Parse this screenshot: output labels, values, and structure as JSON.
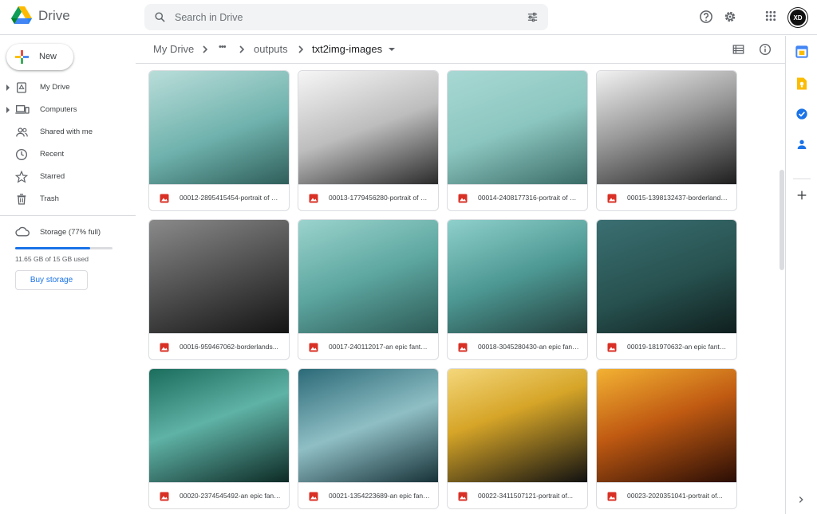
{
  "app": {
    "name": "Drive"
  },
  "search": {
    "placeholder": "Search in Drive"
  },
  "account": {
    "initials": "XD"
  },
  "sidebar": {
    "new_label": "New",
    "items": [
      {
        "label": "My Drive",
        "icon": "my-drive-icon",
        "expandable": true
      },
      {
        "label": "Computers",
        "icon": "computers-icon",
        "expandable": true
      },
      {
        "label": "Shared with me",
        "icon": "shared-icon",
        "expandable": false
      },
      {
        "label": "Recent",
        "icon": "clock-icon",
        "expandable": false
      },
      {
        "label": "Starred",
        "icon": "star-icon",
        "expandable": false
      },
      {
        "label": "Trash",
        "icon": "trash-icon",
        "expandable": false
      }
    ],
    "storage": {
      "label": "Storage (77% full)",
      "used_text": "11.65 GB of 15 GB used",
      "percent": 77,
      "buy_label": "Buy storage"
    }
  },
  "breadcrumb": {
    "items": [
      "My Drive",
      "•••",
      "outputs",
      "txt2img-images"
    ]
  },
  "files": [
    {
      "name": "00012-2895415454-portrait of geralt..."
    },
    {
      "name": "00013-1779456280-portrait of geralt..."
    },
    {
      "name": "00014-2408177316-portrait of geralt..."
    },
    {
      "name": "00015-1398132437-borderlands..."
    },
    {
      "name": "00016-959467062-borderlands..."
    },
    {
      "name": "00017-240112017-an epic fantasy..."
    },
    {
      "name": "00018-3045280430-an epic fantasy..."
    },
    {
      "name": "00019-181970632-an epic fantasy..."
    },
    {
      "name": "00020-2374545492-an epic fantasy..."
    },
    {
      "name": "00021-1354223689-an epic fantasy..."
    },
    {
      "name": "00022-3411507121-portrait of..."
    },
    {
      "name": "00023-2020351041-portrait of..."
    }
  ],
  "colors": {
    "accent": "#1a73e8",
    "image_file_icon": "#d93025"
  }
}
